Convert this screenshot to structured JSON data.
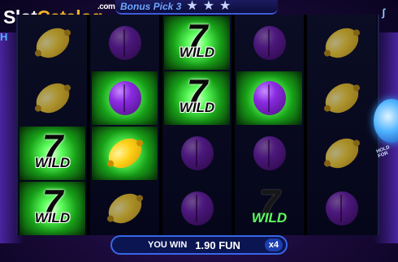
{
  "logo": {
    "slot": "Slot",
    "catalog": "Catalog",
    "dotcom": ".com"
  },
  "left_fragment": "H",
  "bonus": {
    "label": "Bonus Pick 3",
    "stars": [
      "★",
      "★",
      "★"
    ]
  },
  "top_right_icon": "ʃ",
  "reels": [
    [
      "lemon",
      "lemon",
      "wild",
      "wild"
    ],
    [
      "plum",
      "plum",
      "lemon",
      "lemon"
    ],
    [
      "wild",
      "wild",
      "plum",
      "plum"
    ],
    [
      "plum",
      "plum",
      "plum",
      "wild"
    ],
    [
      "lemon",
      "lemon",
      "lemon",
      "plum"
    ]
  ],
  "wild_text": {
    "seven": "7",
    "word": "WILD"
  },
  "win": {
    "label": "YOU WIN",
    "amount": "1.90 FUN",
    "multiplier": "x4"
  },
  "hold_text": "HOLD FOR",
  "colors": {
    "accent": "#3767e8",
    "glow": "#5cff5c",
    "lemon": "#ffd21a",
    "plum": "#8a2be2"
  }
}
